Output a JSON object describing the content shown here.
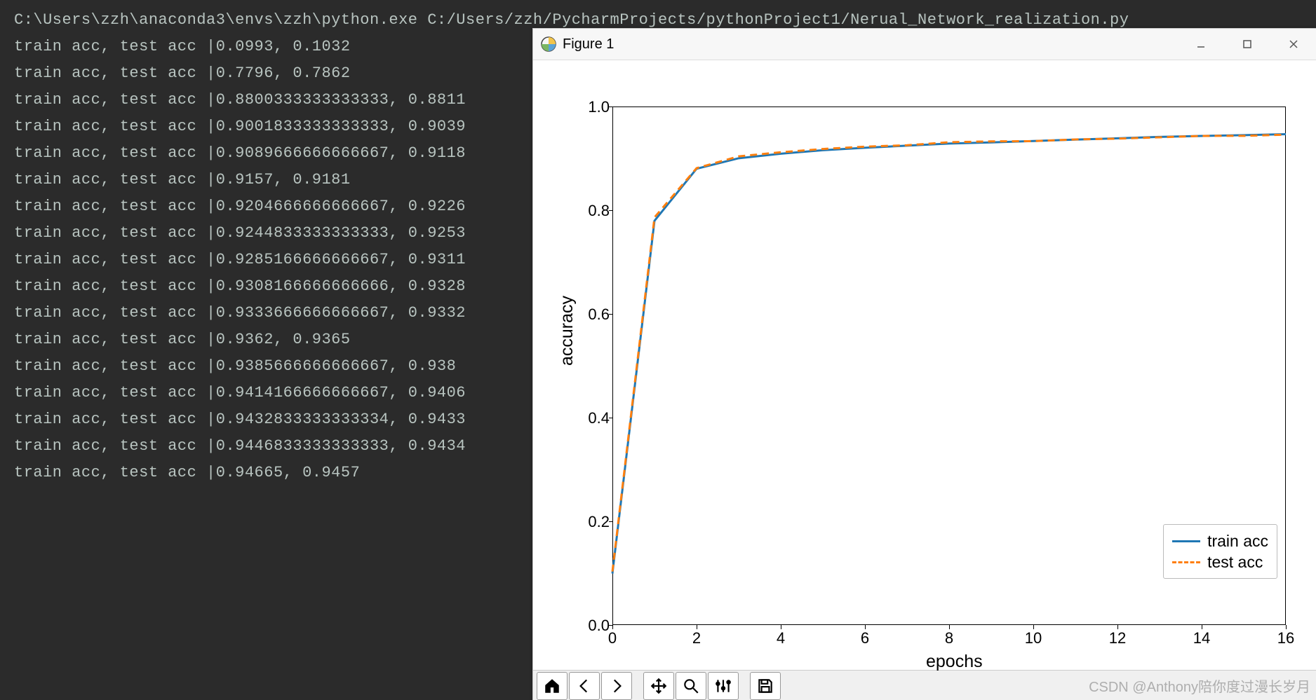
{
  "console": {
    "command": "C:\\Users\\zzh\\anaconda3\\envs\\zzh\\python.exe C:/Users/zzh/PycharmProjects/pythonProject1/Nerual_Network_realization.py",
    "prefix": "train acc, test acc |",
    "rows": [
      {
        "train": "0.0993",
        "test": "0.1032"
      },
      {
        "train": "0.7796",
        "test": "0.7862"
      },
      {
        "train": "0.8800333333333333",
        "test": "0.8811"
      },
      {
        "train": "0.9001833333333333",
        "test": "0.9039"
      },
      {
        "train": "0.9089666666666667",
        "test": "0.9118"
      },
      {
        "train": "0.9157",
        "test": "0.9181"
      },
      {
        "train": "0.9204666666666667",
        "test": "0.9226"
      },
      {
        "train": "0.9244833333333333",
        "test": "0.9253"
      },
      {
        "train": "0.9285166666666667",
        "test": "0.9311"
      },
      {
        "train": "0.9308166666666666",
        "test": "0.9328"
      },
      {
        "train": "0.9333666666666667",
        "test": "0.9332"
      },
      {
        "train": "0.9362",
        "test": "0.9365"
      },
      {
        "train": "0.9385666666666667",
        "test": "0.938"
      },
      {
        "train": "0.9414166666666667",
        "test": "0.9406"
      },
      {
        "train": "0.9432833333333334",
        "test": "0.9433"
      },
      {
        "train": "0.9446833333333333",
        "test": "0.9434"
      },
      {
        "train": "0.94665",
        "test": "0.9457"
      }
    ]
  },
  "figure_window": {
    "title": "Figure 1",
    "buttons": {
      "minimize": "Minimize",
      "maximize": "Maximize",
      "close": "Close"
    },
    "toolbar": {
      "home": "Home",
      "back": "Back",
      "forward": "Forward",
      "pan": "Pan",
      "zoom": "Zoom",
      "configure": "Configure subplots",
      "save": "Save"
    }
  },
  "chart_data": {
    "type": "line",
    "xlabel": "epochs",
    "ylabel": "accuracy",
    "xlim": [
      0,
      16
    ],
    "ylim": [
      0.0,
      1.0
    ],
    "xticks": [
      0,
      2,
      4,
      6,
      8,
      10,
      12,
      14,
      16
    ],
    "yticks": [
      0.0,
      0.2,
      0.4,
      0.6,
      0.8,
      1.0
    ],
    "x": [
      0,
      1,
      2,
      3,
      4,
      5,
      6,
      7,
      8,
      9,
      10,
      11,
      12,
      13,
      14,
      15,
      16
    ],
    "series": [
      {
        "name": "train acc",
        "style": "solid",
        "color": "#1f77b4",
        "values": [
          0.0993,
          0.7796,
          0.88,
          0.9002,
          0.909,
          0.9157,
          0.9205,
          0.9245,
          0.9285,
          0.9308,
          0.9334,
          0.9362,
          0.9386,
          0.9414,
          0.9433,
          0.9447,
          0.9467
        ]
      },
      {
        "name": "test acc",
        "style": "dash",
        "color": "#ff7f0e",
        "values": [
          0.1032,
          0.7862,
          0.8811,
          0.9039,
          0.9118,
          0.9181,
          0.9226,
          0.9253,
          0.9311,
          0.9328,
          0.9332,
          0.9365,
          0.938,
          0.9406,
          0.9433,
          0.9434,
          0.9457
        ]
      }
    ],
    "legend": {
      "entries": [
        "train acc",
        "test acc"
      ],
      "position": "lower right"
    }
  },
  "watermark": "CSDN @Anthony陪你度过漫长岁月"
}
